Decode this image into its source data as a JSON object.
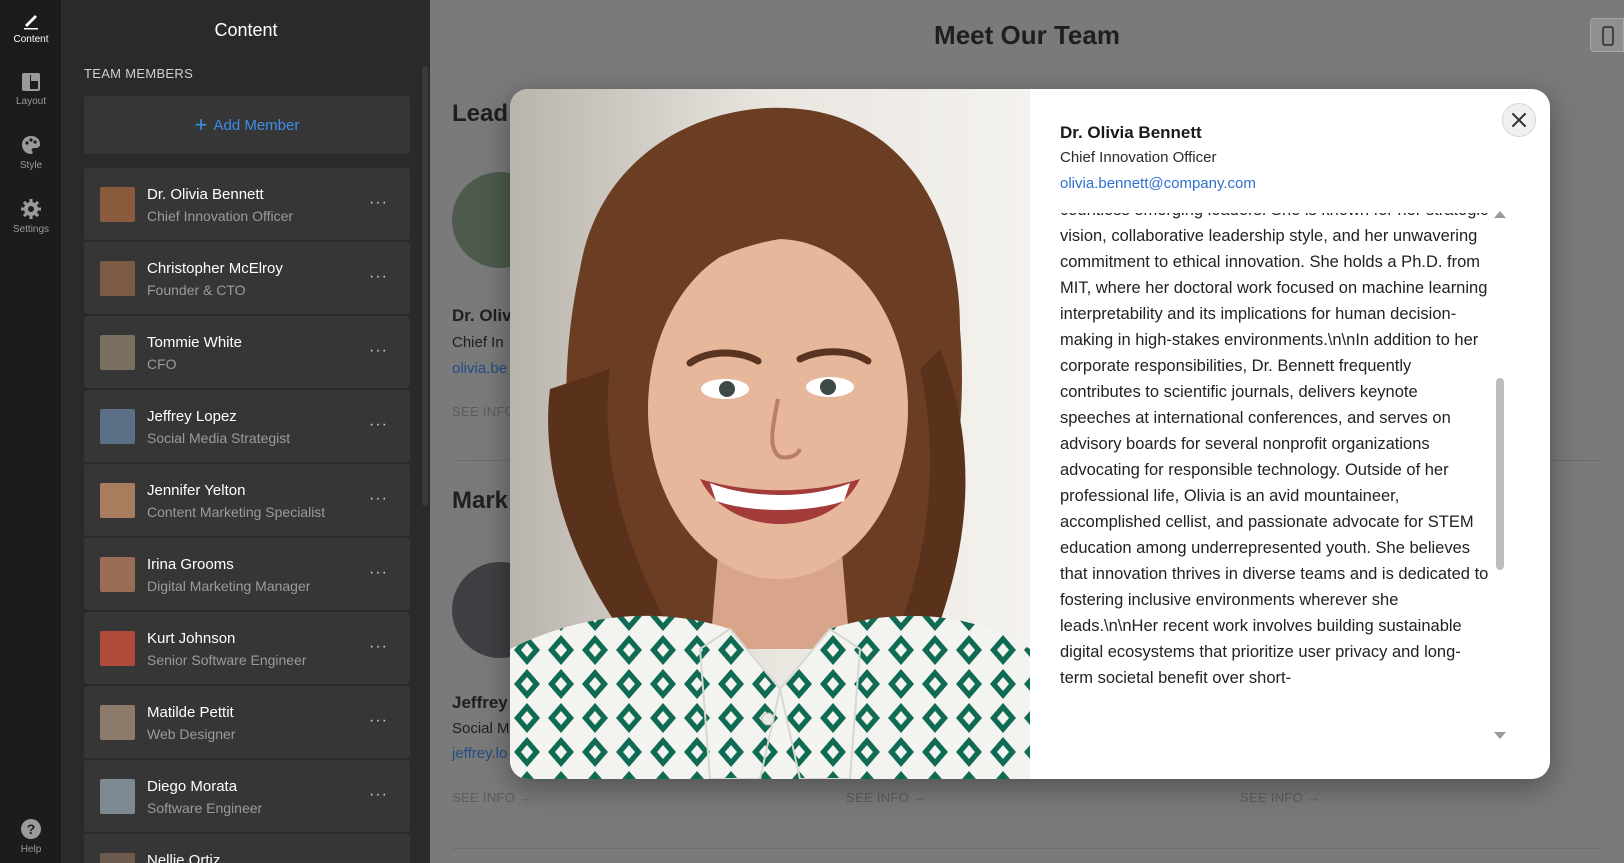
{
  "rail": {
    "items": [
      {
        "label": "Content",
        "icon": "pencil-icon"
      },
      {
        "label": "Layout",
        "icon": "layout-icon"
      },
      {
        "label": "Style",
        "icon": "palette-icon"
      },
      {
        "label": "Settings",
        "icon": "gear-icon"
      }
    ],
    "help_label": "Help"
  },
  "panel": {
    "title": "Content",
    "section_label": "TEAM MEMBERS",
    "add_button_label": "Add Member",
    "members": [
      {
        "name": "Dr. Olivia Bennett",
        "role": "Chief Innovation Officer"
      },
      {
        "name": "Christopher McElroy",
        "role": "Founder & CTO"
      },
      {
        "name": "Tommie White",
        "role": "CFO"
      },
      {
        "name": "Jeffrey Lopez",
        "role": "Social Media Strategist"
      },
      {
        "name": "Jennifer Yelton",
        "role": "Content Marketing Specialist"
      },
      {
        "name": "Irina Grooms",
        "role": "Digital Marketing Manager"
      },
      {
        "name": "Kurt Johnson",
        "role": "Senior Software Engineer"
      },
      {
        "name": "Matilde Pettit",
        "role": "Web Designer"
      },
      {
        "name": "Diego Morata",
        "role": "Software Engineer"
      },
      {
        "name": "Nellie Ortiz",
        "role": ""
      }
    ],
    "more_label": "···"
  },
  "preview": {
    "title": "Meet Our Team",
    "section1_heading": "Lead",
    "section2_heading": "Mark",
    "card1_name": "Dr. Oliv",
    "card1_role": "Chief In",
    "card1_link": "olivia.be",
    "card2_name": "Jeffrey",
    "card2_role": "Social M",
    "card2_link": "jeffrey.lo",
    "see_info": "SEE INFO →"
  },
  "modal": {
    "name": "Dr. Olivia Bennett",
    "title": "Chief Innovation Officer",
    "email": "olivia.bennett@company.com",
    "bio": "countless emerging leaders. She is known for her strategic vision, collaborative leadership style, and her unwavering commitment to ethical innovation. She holds a Ph.D. from MIT, where her doctoral work focused on machine learning interpretability and its implications for human decision-making in high-stakes environments.\\n\\nIn addition to her corporate responsibilities, Dr. Bennett frequently contributes to scientific journals, delivers keynote speeches at international conferences, and serves on advisory boards for several nonprofit organizations advocating for responsible technology. Outside of her professional life, Olivia is an avid mountaineer, accomplished cellist, and passionate advocate for STEM education among underrepresented youth. She believes that innovation thrives in diverse teams and is dedicated to fostering inclusive environments wherever she leads.\\n\\nHer recent work involves building sustainable digital ecosystems that prioritize user privacy and long-term societal benefit over short-"
  },
  "colors": {
    "accent": "#3b8fe8",
    "email_link": "#2f6fd1",
    "panel_bg": "#2a2a2a",
    "card_bg": "#363636"
  }
}
